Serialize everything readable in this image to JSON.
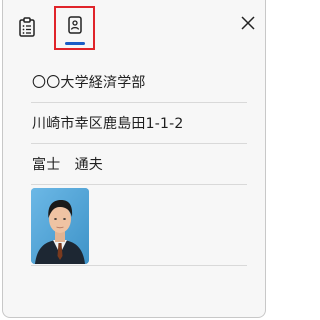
{
  "header": {
    "tabs": [
      {
        "name": "notes",
        "icon": "clipboard-list-icon",
        "selected": false
      },
      {
        "name": "profile",
        "icon": "id-badge-icon",
        "selected": true
      }
    ],
    "close_icon": "close-icon"
  },
  "fields": {
    "school": "〇〇大学経済学部",
    "address": "川崎市幸区鹿島田1-1-2",
    "name": "富士　通夫"
  },
  "photo": {
    "alt": "証明写真"
  },
  "colors": {
    "selected_underline": "#1a5dc7",
    "highlight_border": "#e0242a",
    "photo_background": "#5aa9d8"
  }
}
